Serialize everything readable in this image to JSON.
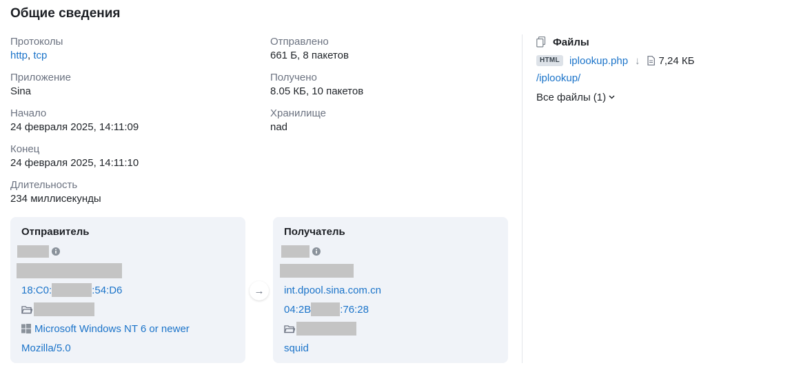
{
  "page_title": "Общие сведения",
  "left_fields": {
    "protocols": {
      "label": "Протоколы",
      "items": [
        "http",
        "tcp"
      ],
      "separator": ","
    },
    "application": {
      "label": "Приложение",
      "value": "Sina"
    },
    "start": {
      "label": "Начало",
      "value": "24 февраля 2025, 14:11:09"
    },
    "end": {
      "label": "Конец",
      "value": "24 февраля 2025, 14:11:10"
    },
    "duration": {
      "label": "Длительность",
      "value": "234 миллисекунды"
    }
  },
  "mid_fields": {
    "sent": {
      "label": "Отправлено",
      "value": "661 Б, 8 пакетов"
    },
    "received": {
      "label": "Получено",
      "value": "8.05 КБ, 10 пакетов"
    },
    "storage": {
      "label": "Хранилище",
      "value": "nad"
    }
  },
  "files": {
    "title": "Файлы",
    "file": {
      "type_badge": "HTML",
      "name": "iplookup.php",
      "direction": "↓",
      "size": "7,24 КБ"
    },
    "path": "/iplookup/",
    "all_files_label": "Все файлы (1)"
  },
  "sender": {
    "title": "Отправитель",
    "mac_prefix": "18:C0:",
    "mac_suffix": ":54:D6",
    "os": "Microsoft Windows NT 6 or newer",
    "user_agent": "Mozilla/5.0"
  },
  "receiver": {
    "title": "Получатель",
    "hostname": "int.dpool.sina.com.cn",
    "mac_prefix": "04:2B",
    "mac_suffix": ":76:28",
    "software": "squid"
  },
  "flow_arrow": "→",
  "colors": {
    "link": "#1a73c9",
    "card_bg": "#f0f3f8",
    "redaction": "#c4c4c4",
    "label": "#6b7280"
  }
}
